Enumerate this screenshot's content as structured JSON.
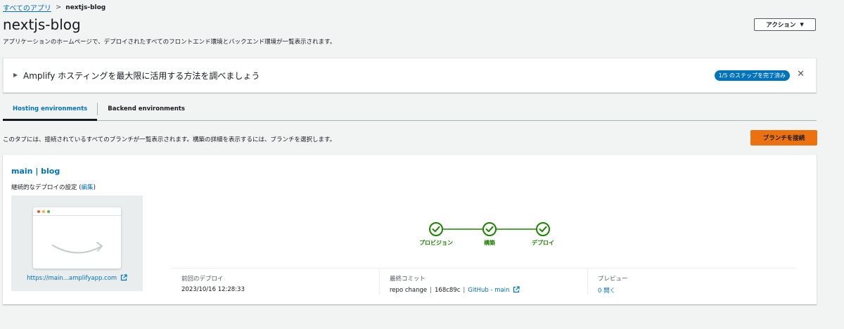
{
  "breadcrumb": {
    "root": "すべてのアプリ",
    "separator": ">",
    "current": "nextjs-blog"
  },
  "header": {
    "title": "nextjs-blog",
    "description": "アプリケーションのホームページで、デプロイされたすべてのフロントエンド環境とバックエンド環境が一覧表示されます。",
    "action_label": "アクション"
  },
  "banner": {
    "title": "Amplify ホスティングを最大限に活用する方法を調べましょう",
    "progress": "1/5 のステップを完了済み"
  },
  "tabs": [
    {
      "label": "Hosting environments",
      "active": true
    },
    {
      "label": "Backend environments",
      "active": false
    }
  ],
  "tab_description": "このタブには、接続されているすべてのブランチが一覧表示されます。構築の詳細を表示するには、ブランチを選択します。",
  "connect_branch_label": "ブランチを接続",
  "branch": {
    "title": "main | blog",
    "setting_text": "継続的なデプロイの設定",
    "setting_open": " (",
    "edit_label": "編集",
    "setting_close": ")",
    "preview_url": "https://main...amplifyapp.com",
    "steps": [
      {
        "label": "プロビジョン",
        "status": "complete"
      },
      {
        "label": "構築",
        "status": "complete"
      },
      {
        "label": "デプロイ",
        "status": "complete"
      }
    ],
    "info": {
      "last_deploy_label": "前回のデプロイ",
      "last_deploy_value": "2023/10/16 12:28:33",
      "last_commit_label": "最終コミット",
      "commit_message": "repo change",
      "commit_hash": "168c89c",
      "commit_source": "GitHub - main",
      "separator": "|",
      "preview_label": "プレビュー",
      "preview_value": "0 開く"
    }
  },
  "colors": {
    "link": "#0073bb",
    "primary_button": "#ec7211",
    "success": "#1d8102",
    "background": "#f2f3f3"
  }
}
